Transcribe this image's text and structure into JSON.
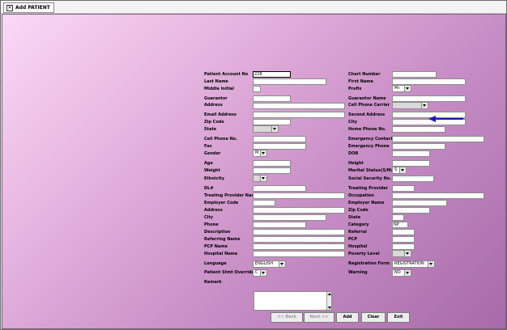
{
  "window": {
    "tab_label": "Add PATIENT"
  },
  "form": {
    "patient_account_no_label": "Patient Account No",
    "patient_account_no_value": "228",
    "last_name_label": "Last Name",
    "middle_initial_label": "Middle Initial",
    "guarantor_label": "Guarantor",
    "address_label": "Address",
    "email_label": "Email Address",
    "zip_label": "Zip Code",
    "state_label": "State",
    "cell_phone_label": "Cell Phone No.",
    "fax_label": "Fax",
    "gender_label": "Gender",
    "gender_value": "M",
    "age_label": "Age",
    "weight_label": "Weight",
    "ethnicity_label": "Ethnicity",
    "dl_label": "DL#",
    "treating_provider_name_label": "Treating Provider Name",
    "employer_code_label": "Employer Code",
    "address2_label": "Address",
    "city_label": "City",
    "phone_label": "Phone",
    "description_label": "Description",
    "referring_name_label": "Referring Name",
    "pcp_name_label": "PCP Name",
    "hospital_name_label": "Hospital Name",
    "language_label": "Language",
    "language_value": "ENGLISH",
    "patient_stmt_override_label": "Patient Stmt Override",
    "patient_stmt_override_value": "C",
    "remark_label": "Remark",
    "chart_number_label": "Chart Number",
    "first_name_label": "First Name",
    "prefix_label": "Prefix",
    "prefix_value": "Mr.",
    "guarantor_name_label": "Guarantor Name",
    "cell_phone_carrier_label": "Cell Phone Carrier",
    "second_address_label": "Second Address",
    "city2_label": "City",
    "home_phone_label": "Home Phone No.",
    "emergency_contact_label": "Emergency Contact",
    "emergency_phone_label": "Emergency Phone",
    "dob_label": "DOB",
    "height_label": "Height",
    "marital_status_label": "Marital Status(S/M/D)",
    "marital_status_value": "S",
    "ssn_label": "Social Security No.",
    "treating_provider_label": "Treating Provider",
    "occupation_label": "Occupation",
    "employer_name_label": "Employer Name",
    "zip2_label": "Zip Code",
    "state2_label": "State",
    "category_label": "Category",
    "category_value": "NP",
    "referral_label": "Referral",
    "pcp_label": "PCP",
    "hospital_label": "Hospital",
    "poverty_level_label": "Poverty Level",
    "registration_form_label": "Registration Form",
    "registration_form_value": "REGISTRATION",
    "warning_label": "Warning",
    "warning_value": "NO"
  },
  "buttons": {
    "back": "<< Back",
    "next": "Next >>",
    "add": "Add",
    "clear": "Clear",
    "exit": "Exit"
  },
  "colors": {
    "annotation_arrow": "#1a1aa8"
  }
}
